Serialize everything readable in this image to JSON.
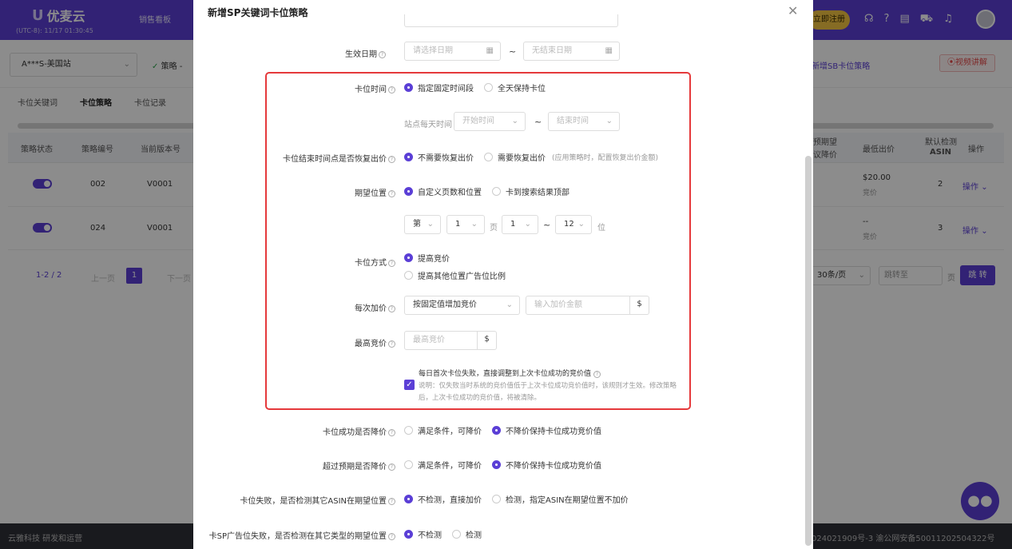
{
  "app": {
    "brand": "优麦云",
    "clock": "(UTC-8): 11/17 01:30:45",
    "nav_first": "销售看板",
    "register": "立即注册",
    "top_icons": [
      "headset-icon",
      "help-icon",
      "message-icon",
      "cart-icon",
      "bell-icon"
    ]
  },
  "subbar": {
    "store": "A***S-美国站",
    "strategy_label": "策略 -",
    "sb_link": "新增SB卡位策略",
    "video": "视频讲解"
  },
  "tabs": [
    "卡位关键词",
    "卡位策略",
    "卡位记录"
  ],
  "table": {
    "headers": {
      "status": "策略状态",
      "code": "策略编号",
      "version": "当前版本号",
      "expect_line1": "预期望",
      "expect_line2": "议降价",
      "min_bid": "最低出价",
      "asin_line1": "默认检测",
      "asin_line2": "ASIN",
      "action": "操作"
    },
    "rows": [
      {
        "code": "002",
        "version": "V0001",
        "min_bid": "$20.00",
        "min_bid_sub": "竞价",
        "asin": "2",
        "action": "操作"
      },
      {
        "code": "024",
        "version": "V0001",
        "min_bid": "--",
        "min_bid_sub": "竞价",
        "asin": "3",
        "action": "操作"
      }
    ]
  },
  "pager": {
    "count": "1-2 / 2",
    "prev": "上一页",
    "current": "1",
    "next": "下一页",
    "page_size": "30条/页",
    "jump_placeholder": "跳转至",
    "jump_unit": "页",
    "jump_btn": "跳 转"
  },
  "footer": {
    "left": "云雅科技 研发和运营",
    "right": "024021909号-3  渝公网安备50011202504322号"
  },
  "modal": {
    "title": "新增SP关键词卡位策略",
    "effective_date": {
      "label": "生效日期",
      "start_placeholder": "请选择日期",
      "end_placeholder": "无结束日期"
    },
    "slot_time": {
      "label": "卡位时间",
      "opt_fixed": "指定固定时间段",
      "opt_all_day": "全天保持卡位",
      "daily_label": "站点每天时间",
      "start_placeholder": "开始时间",
      "end_placeholder": "结束时间"
    },
    "restore_bid": {
      "label": "卡位结束时间点是否恢复出价",
      "opt_no": "不需要恢复出价",
      "opt_yes": "需要恢复出价",
      "opt_yes_note": "(应用策略时，配置恢复出价金额)"
    },
    "expected_position": {
      "label": "期望位置",
      "opt_custom": "自定义页数和位置",
      "opt_top": "卡到搜索结果顶部",
      "prefix": "第",
      "page_value": "1",
      "page_unit": "页",
      "from_value": "1",
      "to_value": "12",
      "pos_unit": "位"
    },
    "method": {
      "label": "卡位方式",
      "opt_raise_bid": "提高竞价",
      "opt_raise_ratio": "提高其他位置广告位比例"
    },
    "increment": {
      "label": "每次加价",
      "mode": "按固定值增加竞价",
      "amount_placeholder": "输入加价金额",
      "currency": "$"
    },
    "max_bid": {
      "label": "最高竞价",
      "placeholder": "最高竞价",
      "currency": "$"
    },
    "first_fail": {
      "title": "每日首次卡位失败，直接调整到上次卡位成功的竞价值",
      "desc": "说明：仅失败当时系统的竞价值低于上次卡位成功竞价值时，该规则才生效。修改策略后，上次卡位成功的竞价值，将被清除。"
    },
    "success_lower": {
      "label": "卡位成功是否降价",
      "opt_yes": "满足条件，可降价",
      "opt_no": "不降价保持卡位成功竞价值"
    },
    "over_expect_lower": {
      "label": "超过预期是否降价",
      "opt_yes": "满足条件，可降价",
      "opt_no": "不降价保持卡位成功竞价值"
    },
    "check_asin": {
      "label": "卡位失败，是否检测其它ASIN在期望位置",
      "opt_no": "不检测，直接加价",
      "opt_yes": "检测，指定ASIN在期望位置不加价"
    },
    "check_other_type": {
      "label": "卡SP广告位失败，是否检测在其它类型的期望位置",
      "opt_no": "不检测",
      "opt_yes": "检测"
    }
  }
}
